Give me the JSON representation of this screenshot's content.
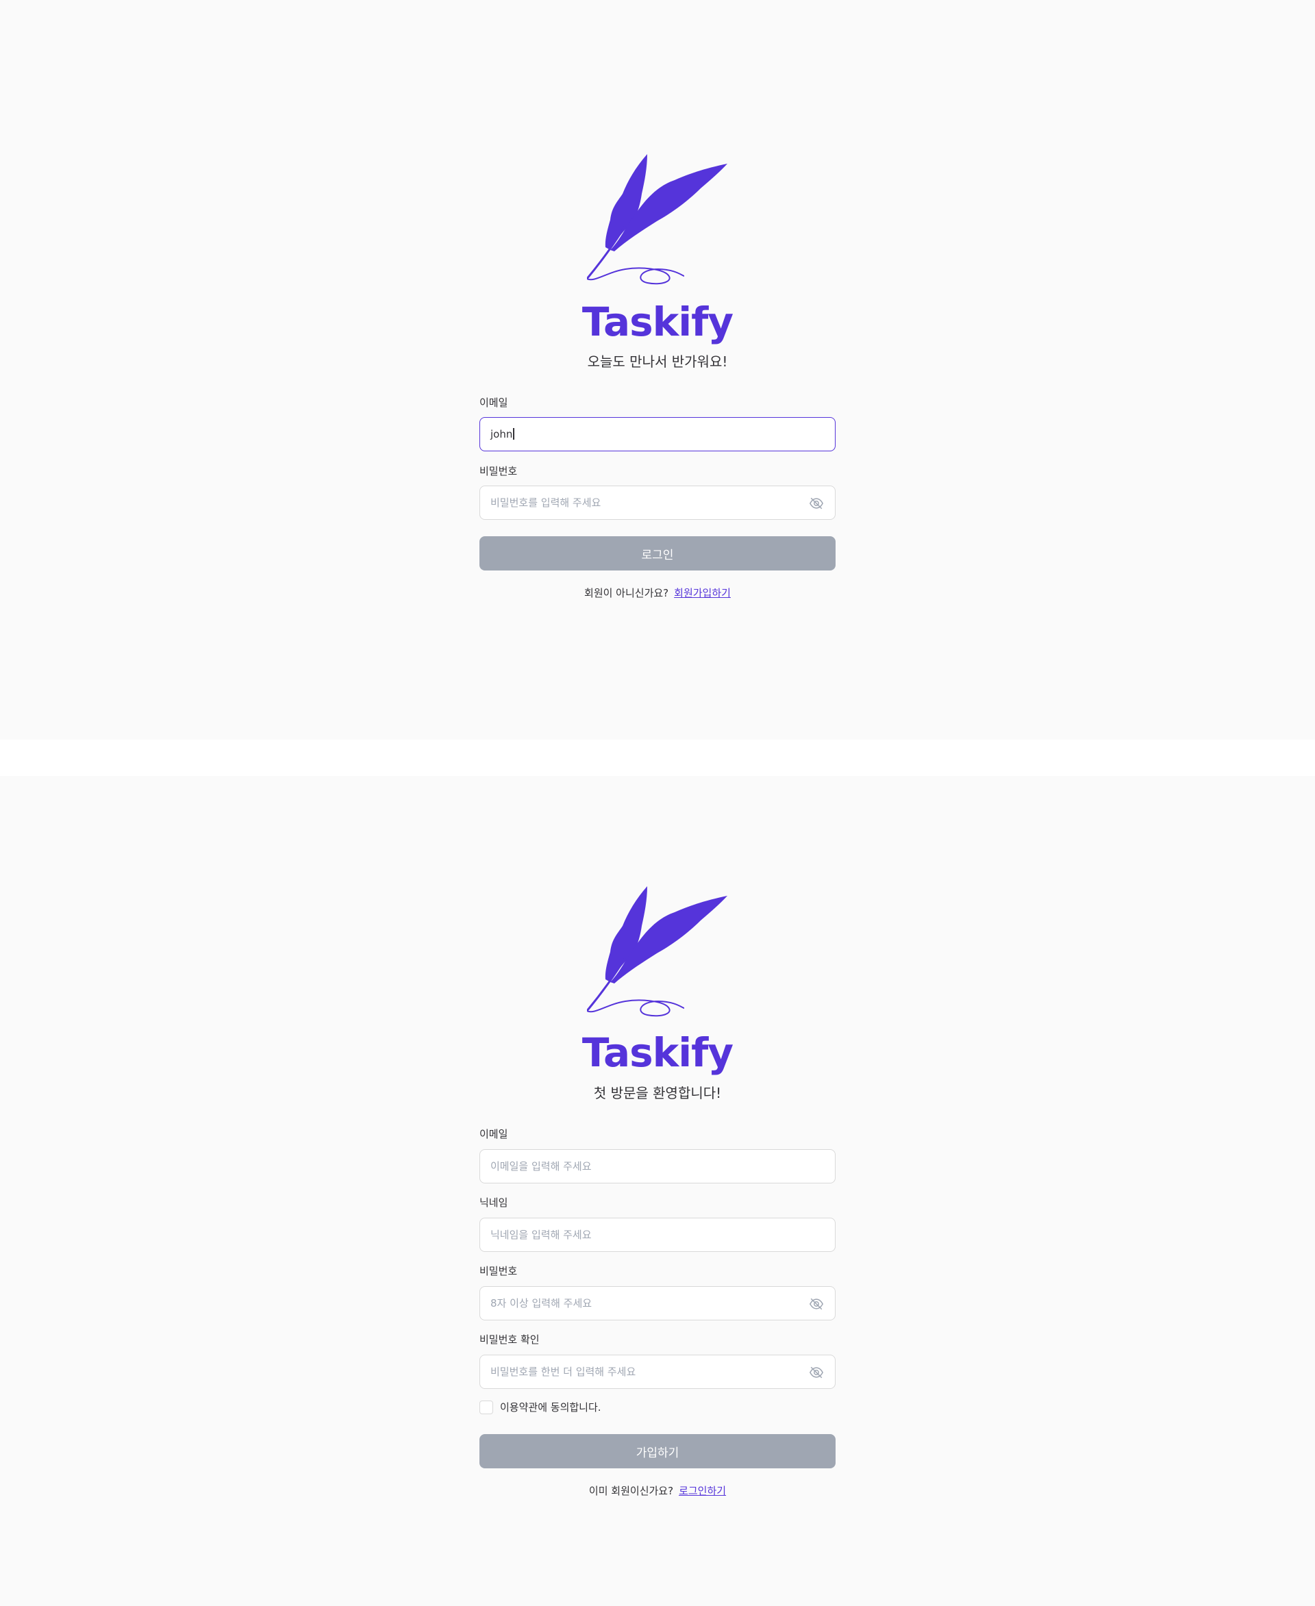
{
  "brand": {
    "name": "Taskify",
    "logo_icon": "quill-feather-icon",
    "accent": "#5534DA"
  },
  "login": {
    "greeting": "오늘도 만나서 반가워요!",
    "email": {
      "label": "이메일",
      "value": "john"
    },
    "password": {
      "label": "비밀번호",
      "placeholder": "비밀번호를 입력해 주세요",
      "toggle_icon": "eye-off-icon"
    },
    "submit_label": "로그인",
    "switch_text": "회원이 아니신가요?",
    "switch_link": "회원가입하기"
  },
  "signup": {
    "greeting": "첫 방문을 환영합니다!",
    "email": {
      "label": "이메일",
      "placeholder": "이메일을 입력해 주세요"
    },
    "nickname": {
      "label": "닉네임",
      "placeholder": "닉네임을 입력해 주세요"
    },
    "password": {
      "label": "비밀번호",
      "placeholder": "8자 이상 입력해 주세요",
      "toggle_icon": "eye-off-icon"
    },
    "password_confirm": {
      "label": "비밀번호 확인",
      "placeholder": "비밀번호를 한번 더 입력해 주세요",
      "toggle_icon": "eye-off-icon"
    },
    "terms_label": "이용약관에 동의합니다.",
    "terms_checked": false,
    "submit_label": "가입하기",
    "switch_text": "이미 회원이신가요?",
    "switch_link": "로그인하기"
  },
  "colors": {
    "disabled_button": "#9FA6B2",
    "focus_border": "#5534DA",
    "background": "#FAFAFA"
  }
}
